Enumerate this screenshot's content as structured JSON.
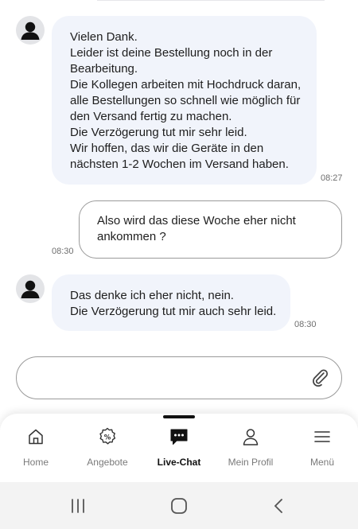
{
  "messages": [
    {
      "direction": "incoming",
      "lines": [
        "Vielen Dank.",
        "Leider ist deine Bestellung noch in der",
        "Bearbeitung.",
        "Die Kollegen arbeiten mit Hochdruck daran,",
        "alle Bestellungen so schnell wie möglich für",
        "den Versand fertig zu machen.",
        "Die Verzögerung tut mir sehr leid.",
        "Wir hoffen, das wir die Geräte in den",
        "nächsten 1-2 Wochen im Versand haben."
      ],
      "time": "08:27"
    },
    {
      "direction": "outgoing",
      "lines": [
        "Also wird das diese Woche eher nicht",
        "ankommen ?"
      ],
      "time": "08:30"
    },
    {
      "direction": "incoming",
      "lines": [
        "Das denke ich eher nicht, nein.",
        "Die Verzögerung tut mir auch sehr leid."
      ],
      "time": "08:30"
    }
  ],
  "composer": {
    "attach_icon": "paperclip-icon"
  },
  "nav": {
    "items": [
      {
        "label": "Home",
        "icon": "home-icon",
        "active": false
      },
      {
        "label": "Angebote",
        "icon": "percent-badge-icon",
        "active": false
      },
      {
        "label": "Live-Chat",
        "icon": "chat-bubble-icon",
        "active": true
      },
      {
        "label": "Mein Profil",
        "icon": "person-icon",
        "active": false
      },
      {
        "label": "Menü",
        "icon": "hamburger-menu-icon",
        "active": false
      }
    ]
  },
  "system_nav": {
    "buttons": [
      "recent-apps-icon",
      "home-circle-icon",
      "back-chevron-icon"
    ]
  },
  "colors": {
    "incoming_bubble": "#f1f4fb",
    "outgoing_border": "#9a9a9a",
    "active_nav": "#111111",
    "inactive_nav": "#7a7a7a"
  }
}
